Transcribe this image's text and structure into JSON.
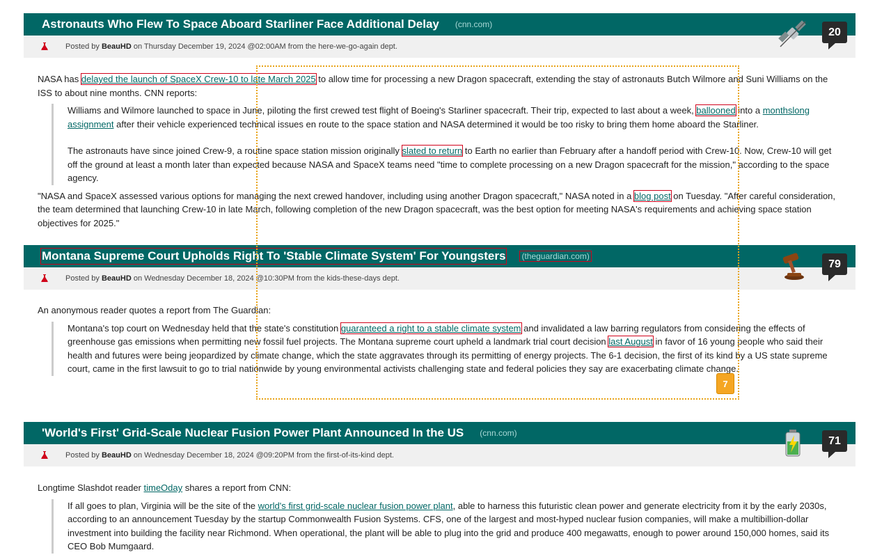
{
  "stories": [
    {
      "title": "Astronauts Who Flew To Space Aboard Starliner Face Additional Delay",
      "source": "(cnn.com)",
      "comments": "20",
      "topic_icon": "satellite-icon",
      "meta": {
        "posted_by": "Posted by",
        "author": "BeauHD",
        "date": "on Thursday December 19, 2024 @02:00AM from the here-we-go-again dept."
      },
      "intro_pre": "NASA has ",
      "intro_link": "delayed the launch of SpaceX Crew-10 to late March 2025",
      "intro_post": " to allow time for processing a new Dragon spacecraft, extending the stay of astronauts Butch Wilmore and Suni Williams on the ISS to about nine months. CNN reports:",
      "q1_pre": "Williams and Wilmore launched to space in June, piloting the first crewed test flight of Boeing's Starliner spacecraft. Their trip, expected to last about a week, ",
      "q1_link1": "ballooned",
      "q1_mid": " into a ",
      "q1_link2": "monthslong assignment",
      "q1_post": " after their vehicle experienced technical issues en route to the space station and NASA determined it would be too risky to bring them home aboard the Starliner.",
      "q2_pre": "The astronauts have since joined Crew-9, a routine space station mission originally ",
      "q2_link": "slated to return",
      "q2_post": " to Earth no earlier than February after a handoff period with Crew-10. Now, Crew-10 will get off the ground at least a month later than expected because NASA and SpaceX teams need \"time to complete processing on a new Dragon spacecraft for the mission,\" according to the space agency.",
      "out_pre": "\"NASA and SpaceX assessed various options for managing the next crewed handover, including using another Dragon spacecraft,\" NASA noted in a ",
      "out_link": "blog post",
      "out_post": " on Tuesday. \"After careful consideration, the team determined that launching Crew-10 in late March, following completion of the new Dragon spacecraft, was the best option for meeting NASA's requirements and achieving space station objectives for 2025.\""
    },
    {
      "title": "Montana Supreme Court Upholds Right To 'Stable Climate System' For Youngsters",
      "source": "(theguardian.com)",
      "comments": "79",
      "topic_icon": "gavel-icon",
      "meta": {
        "posted_by": "Posted by",
        "author": "BeauHD",
        "date": "on Wednesday December 18, 2024 @10:30PM from the kids-these-days dept."
      },
      "intro": "An anonymous reader quotes a report from The Guardian:",
      "q_pre": "Montana's top court on Wednesday held that the state's constitution ",
      "q_link1": "guaranteed a right to a stable climate system",
      "q_mid": " and invalidated a law barring regulators from considering the effects of greenhouse gas emissions when permitting new fossil fuel projects. The Montana supreme court upheld a landmark trial court decision ",
      "q_link2": "last August",
      "q_post": " in favor of 16 young people who said their health and futures were being jeopardized by climate change, which the state aggravates through its permitting of energy projects. The 6-1 decision, the first of its kind by a US state supreme court, came in the first lawsuit to go to trial nationwide by young environmental activists challenging state and federal policies they say are exacerbating climate change."
    },
    {
      "title": "'World's First' Grid-Scale Nuclear Fusion Power Plant Announced In the US",
      "source": "(cnn.com)",
      "comments": "71",
      "topic_icon": "battery-icon",
      "meta": {
        "posted_by": "Posted by",
        "author": "BeauHD",
        "date": "on Wednesday December 18, 2024 @09:20PM from the first-of-its-kind dept."
      },
      "intro_pre": "Longtime Slashdot reader ",
      "intro_link": "timeOday",
      "intro_post": " shares a report from CNN:",
      "q_pre": "If all goes to plan, Virginia will be the site of the ",
      "q_link": "world's first grid-scale nuclear fusion power plant",
      "q_post": ", able to harness this futuristic clean power and generate electricity from it by the early 2030s, according to an announcement Tuesday by the startup Commonwealth Fusion Systems. CFS, one of the largest and most-hyped nuclear fusion companies, will make a multibillion-dollar investment into building the facility near Richmond. When operational, the plant will be able to plug into the grid and produce 400 megawatts, enough to power around 150,000 homes, said its CEO Bob Mumgaard."
    }
  ],
  "overlay_badge": "7",
  "colors": {
    "title_bar": "#016765",
    "meta_bar": "#f0f0f0",
    "link": "#016765",
    "highlight": "#d0021b",
    "overlay": "#e8a317"
  }
}
